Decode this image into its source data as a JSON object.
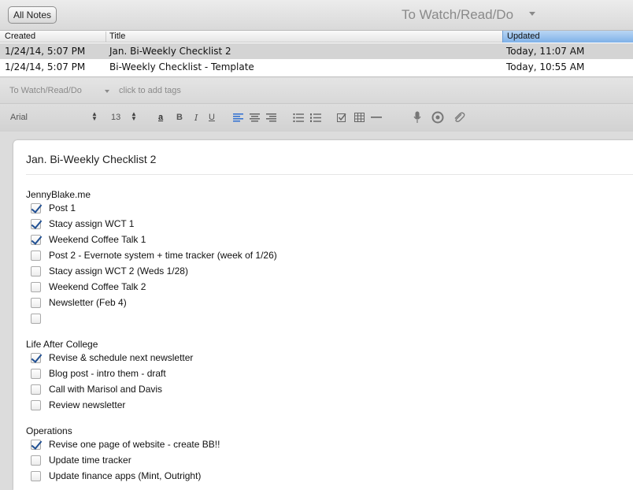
{
  "topbar": {
    "all_notes_label": "All Notes",
    "notebook_title": "To Watch/Read/Do"
  },
  "note_list": {
    "columns": [
      "Created",
      "Title",
      "Updated"
    ],
    "rows": [
      {
        "created": "1/24/14, 5:07 PM",
        "title": "Jan. Bi-Weekly Checklist 2",
        "updated": "Today, 11:07 AM",
        "selected": true
      },
      {
        "created": "1/24/14, 5:07 PM",
        "title": "Bi-Weekly Checklist - Template",
        "updated": "Today, 10:55 AM",
        "selected": false
      }
    ]
  },
  "tagbar": {
    "notebook": "To Watch/Read/Do",
    "add_tags_placeholder": "click to add tags"
  },
  "toolbar": {
    "font": "Arial",
    "font_size": "13",
    "bold": "B",
    "italic": "I",
    "underline": "U",
    "text_color": "a"
  },
  "note": {
    "title": "Jan. Bi-Weekly Checklist 2",
    "sections": [
      {
        "title": "JennyBlake.me",
        "items": [
          {
            "label": "Post 1",
            "checked": true
          },
          {
            "label": "Stacy assign WCT 1",
            "checked": true
          },
          {
            "label": "Weekend Coffee Talk 1",
            "checked": true
          },
          {
            "label": "Post 2 - Evernote system + time tracker (week of 1/26)",
            "checked": false
          },
          {
            "label": "Stacy assign WCT 2 (Weds 1/28)",
            "checked": false
          },
          {
            "label": "Weekend Coffee Talk 2",
            "checked": false
          },
          {
            "label": "Newsletter (Feb 4)",
            "checked": false
          },
          {
            "label": "",
            "checked": false
          }
        ]
      },
      {
        "title": "Life After College",
        "items": [
          {
            "label": "Revise & schedule next newsletter",
            "checked": true
          },
          {
            "label": "Blog post - intro them - draft",
            "checked": false
          },
          {
            "label": "Call with Marisol and Davis",
            "checked": false
          },
          {
            "label": "Review newsletter",
            "checked": false
          }
        ]
      },
      {
        "title": "Operations",
        "items": [
          {
            "label": "Revise one page of website - create BB!!",
            "checked": true
          },
          {
            "label": "Update time tracker",
            "checked": false
          },
          {
            "label": "Update finance apps (Mint, Outright)",
            "checked": false
          }
        ]
      }
    ]
  },
  "colors": {
    "selection_blue": "#7fb1e8",
    "check_blue": "#1f4f93",
    "selected_row": "#d4d4d4"
  }
}
